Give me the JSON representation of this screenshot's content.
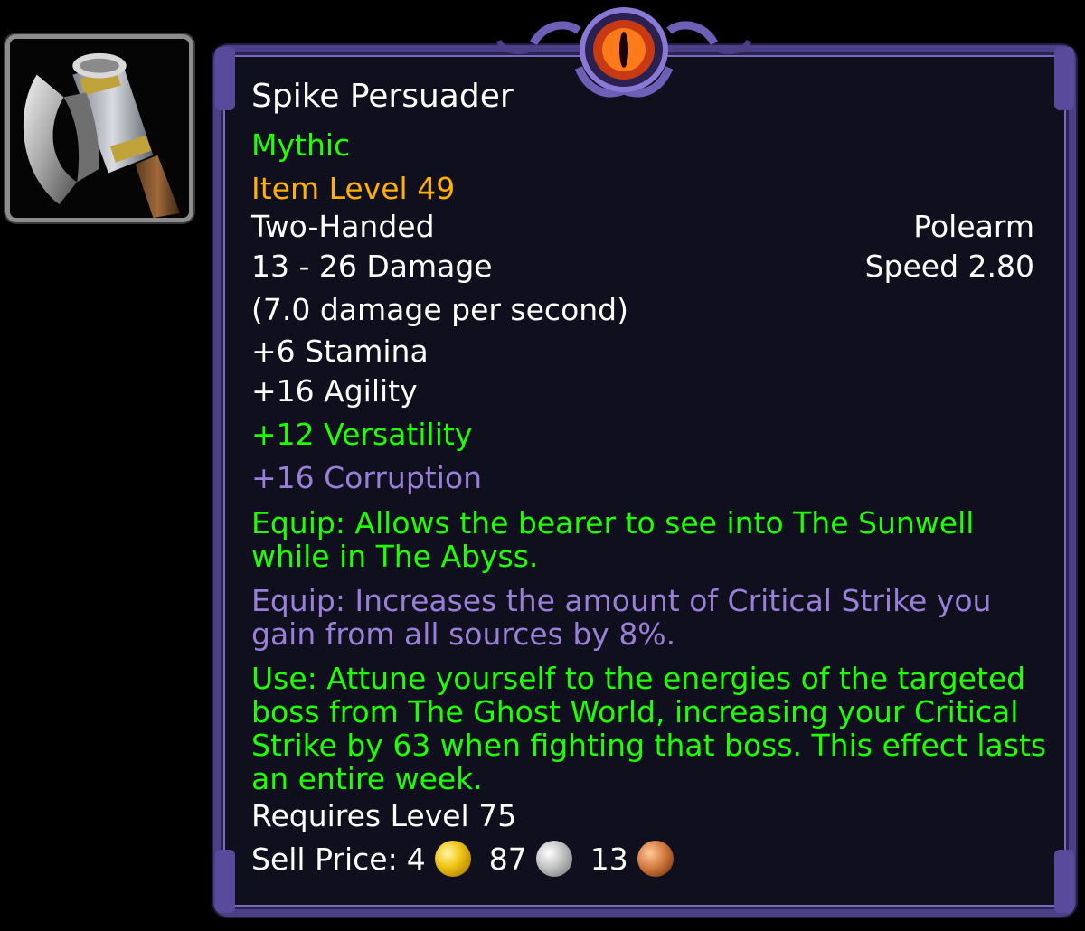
{
  "item": {
    "name": "Spike Persuader",
    "difficulty": "Mythic",
    "item_level": "Item Level 49",
    "slot": "Two-Handed",
    "type": "Polearm",
    "damage": "13 - 26 Damage",
    "speed": "Speed 2.80",
    "dps": "(7.0 damage per second)",
    "stats": {
      "stamina": "+6 Stamina",
      "agility": "+16 Agility",
      "versatility": "+12 Versatility",
      "corruption": "+16 Corruption"
    },
    "effects": {
      "equip_1": "Equip: Allows the bearer to see into The Sunwell while in The Abyss.",
      "equip_2": "Equip: Increases the amount of Critical Strike you gain from all sources by 8%.",
      "use": "Use: Attune yourself to the energies of the targeted boss from The Ghost World, increasing your Critical Strike by 63 when fighting that boss. This effect lasts an entire week."
    },
    "requires_level": "Requires Level 75",
    "sell_price": {
      "label": "Sell Price:",
      "gold": "4",
      "silver": "87",
      "copper": "13"
    },
    "icon": "polearm-axe-icon"
  },
  "colors": {
    "white": "#ffffff",
    "green": "#1eff00",
    "gold": "#ffb100",
    "purple": "#9a7fd9",
    "frame": "#4d3f86",
    "background": "#0f0f1d"
  }
}
